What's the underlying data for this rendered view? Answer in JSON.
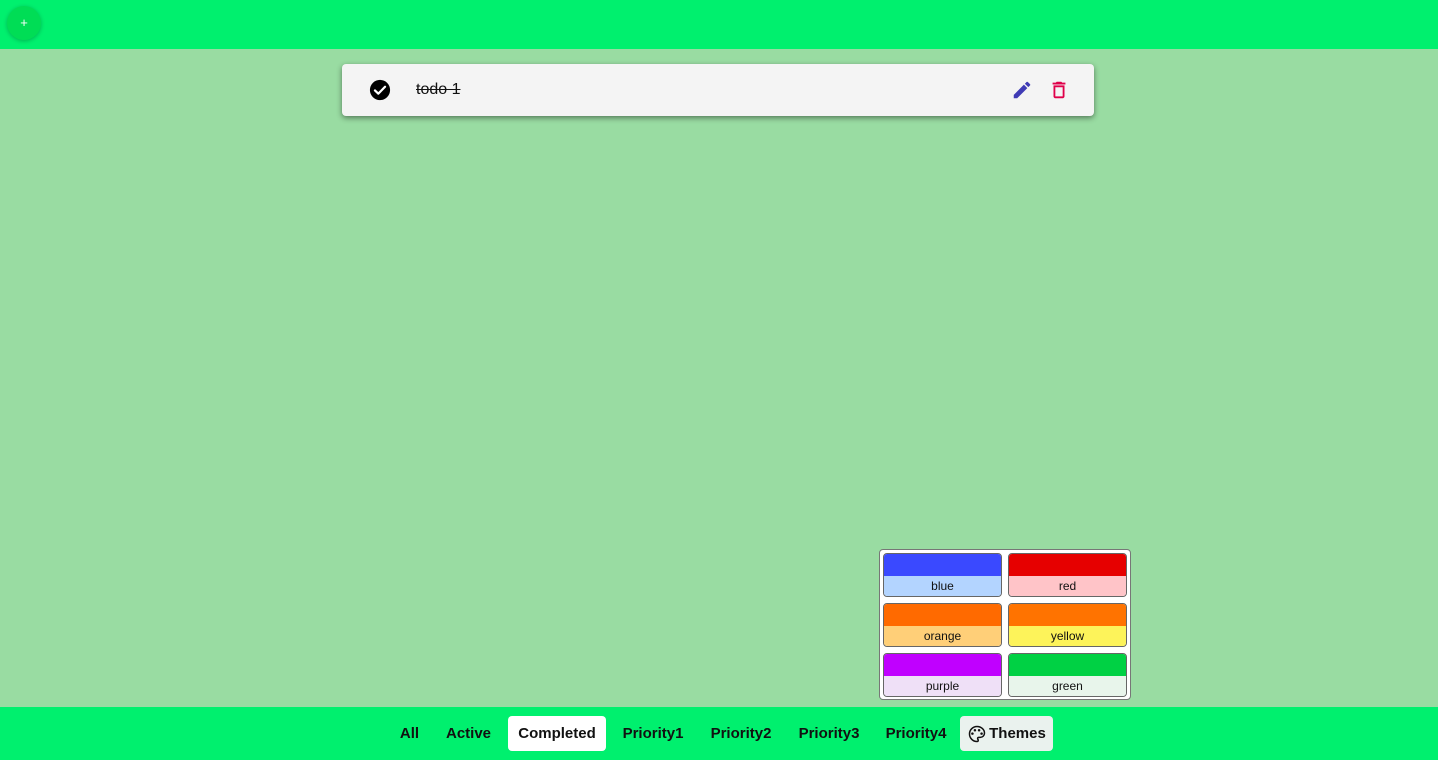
{
  "top_bar": {
    "add_label": "+"
  },
  "todos": [
    {
      "text": "todo 1",
      "completed": true
    }
  ],
  "themes": [
    {
      "label": "blue",
      "primary": "#3a49ff",
      "light": "#b3d4ff"
    },
    {
      "label": "red",
      "primary": "#e60000",
      "light": "#ffc4c8"
    },
    {
      "label": "orange",
      "primary": "#ff6a00",
      "light": "#ffcf78"
    },
    {
      "label": "yellow",
      "primary": "#ff7300",
      "light": "#fdf35a"
    },
    {
      "label": "purple",
      "primary": "#c000ff",
      "light": "#efe0f7"
    },
    {
      "label": "green",
      "primary": "#00d144",
      "light": "#e8f5eb"
    }
  ],
  "filters": {
    "all": "All",
    "active": "Active",
    "completed": "Completed",
    "priority1": "Priority1",
    "priority2": "Priority2",
    "priority3": "Priority3",
    "priority4": "Priority4",
    "themes": "Themes"
  },
  "selected_filter": "Completed",
  "colors": {
    "page_bg": "#99dca2",
    "bar_bg": "#00f06e",
    "edit_icon": "#3f3bb5",
    "delete_icon": "#e0004a"
  }
}
